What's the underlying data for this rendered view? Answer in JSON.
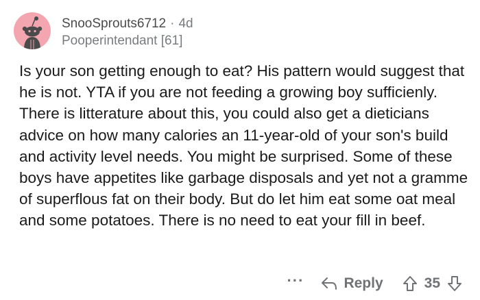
{
  "comment": {
    "author": "SnooSprouts6712",
    "separator": "·",
    "age": "4d",
    "flair": "Pooperintendant [61]",
    "body": "Is your son getting enough to eat? His pattern would suggest that he is not. YTA if you are not feeding a growing boy sufficienly. There is litterature about this, you could also get a dieticians advice on how many calories an 11-year-old of your son's build and activity level needs. You might be surprised. Some of these boys have appetites like garbage disposals and yet not a gramme of superflous fat on their body. But do let him eat some oat meal and some potatoes. There is no need to eat your fill in beef."
  },
  "actions": {
    "more": "···",
    "reply_label": "Reply",
    "score": "35"
  },
  "icons": {
    "avatar": "snoo-avatar-icon",
    "more": "more-options-icon",
    "reply": "reply-arrow-icon",
    "upvote": "upvote-arrow-icon",
    "downvote": "downvote-arrow-icon"
  },
  "colors": {
    "avatar_bg": "#f4a6b0",
    "text": "#1a1a1b",
    "muted": "#787c7e",
    "icon": "#6f7274"
  }
}
